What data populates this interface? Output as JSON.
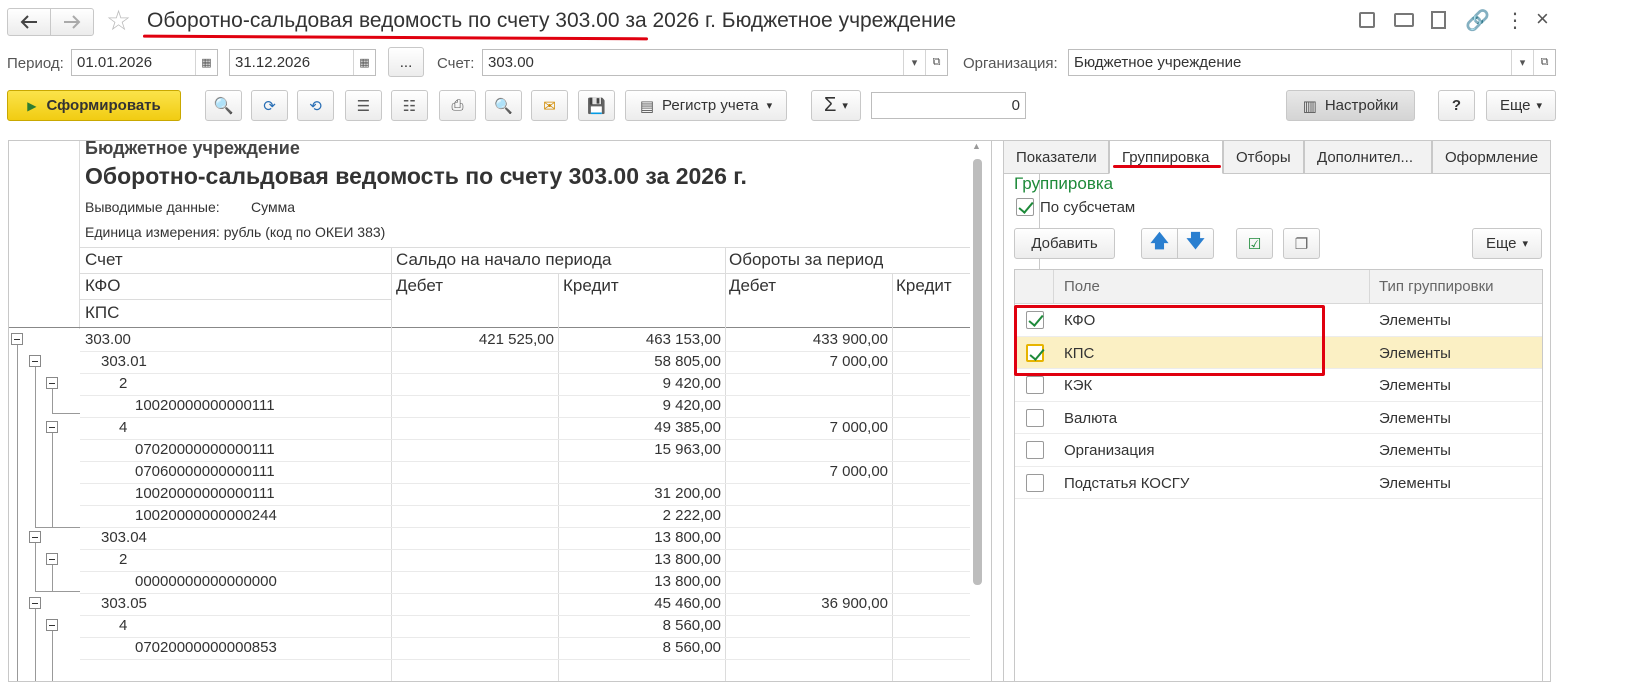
{
  "window": {
    "title": "Оборотно-сальдовая ведомость по счету 303.00 за 2026 г. Бюджетное учреждение"
  },
  "params": {
    "period_label": "Период:",
    "date_from": "01.01.2026",
    "date_to": "31.12.2026",
    "dots": "...",
    "account_label": "Счет:",
    "account_value": "303.00",
    "org_label": "Организация:",
    "org_value": "Бюджетное учреждение"
  },
  "toolbar": {
    "generate": "Сформировать",
    "register": "Регистр учета",
    "sigma": "Σ",
    "sum_value": "0",
    "settings": "Настройки",
    "help": "?",
    "more": "Еще"
  },
  "report": {
    "org": "Бюджетное учреждение",
    "title": "Оборотно-сальдовая ведомость по счету 303.00 за 2026 г.",
    "output_label": "Выводимые данные:",
    "output_value": "Сумма",
    "unit": "Единица измерения: рубль (код по ОКЕИ 383)",
    "headers": {
      "account": "Счет",
      "kfo": "КФО",
      "kps": "КПС",
      "opening": "Сальдо на начало периода",
      "turnover": "Обороты за период",
      "debit1": "Дебет",
      "credit1": "Кредит",
      "debit2": "Дебет",
      "credit2": "Кредит"
    },
    "rows": [
      {
        "name": "303.00",
        "d1": "421 525,00",
        "c1": "463 153,00",
        "d2": "433 900,00"
      },
      {
        "name": "303.01",
        "d1": "",
        "c1": "58 805,00",
        "d2": "7 000,00"
      },
      {
        "name": "2",
        "d1": "",
        "c1": "9 420,00",
        "d2": ""
      },
      {
        "name": "10020000000000111",
        "d1": "",
        "c1": "9 420,00",
        "d2": ""
      },
      {
        "name": "4",
        "d1": "",
        "c1": "49 385,00",
        "d2": "7 000,00"
      },
      {
        "name": "07020000000000111",
        "d1": "",
        "c1": "15 963,00",
        "d2": ""
      },
      {
        "name": "07060000000000111",
        "d1": "",
        "c1": "",
        "d2": "7 000,00"
      },
      {
        "name": "10020000000000111",
        "d1": "",
        "c1": "31 200,00",
        "d2": ""
      },
      {
        "name": "10020000000000244",
        "d1": "",
        "c1": "2 222,00",
        "d2": ""
      },
      {
        "name": "303.04",
        "d1": "",
        "c1": "13 800,00",
        "d2": ""
      },
      {
        "name": "2",
        "d1": "",
        "c1": "13 800,00",
        "d2": ""
      },
      {
        "name": "00000000000000000",
        "d1": "",
        "c1": "13 800,00",
        "d2": ""
      },
      {
        "name": "303.05",
        "d1": "",
        "c1": "45 460,00",
        "d2": "36 900,00"
      },
      {
        "name": "4",
        "d1": "",
        "c1": "8 560,00",
        "d2": ""
      },
      {
        "name": "07020000000000853",
        "d1": "",
        "c1": "8 560,00",
        "d2": ""
      }
    ]
  },
  "settings_panel": {
    "tabs": [
      "Показатели",
      "Группировка",
      "Отборы",
      "Дополнител...",
      "Оформление"
    ],
    "section_title": "Группировка",
    "by_subaccounts": "По субсчетам",
    "add": "Добавить",
    "more": "Еще",
    "col_field": "Поле",
    "col_type": "Тип группировки",
    "rows": [
      {
        "field": "КФО",
        "type": "Элементы",
        "checked": true
      },
      {
        "field": "КПС",
        "type": "Элементы",
        "checked": true
      },
      {
        "field": "КЭК",
        "type": "Элементы",
        "checked": false
      },
      {
        "field": "Валюта",
        "type": "Элементы",
        "checked": false
      },
      {
        "field": "Организация",
        "type": "Элементы",
        "checked": false
      },
      {
        "field": "Подстатья КОСГУ",
        "type": "Элементы",
        "checked": false
      }
    ]
  },
  "colors": {
    "accent_red": "#e0000f",
    "generate_yellow": "#f5d51a",
    "section_green": "#1e8a3a",
    "selected_row": "#fbf0c4"
  }
}
